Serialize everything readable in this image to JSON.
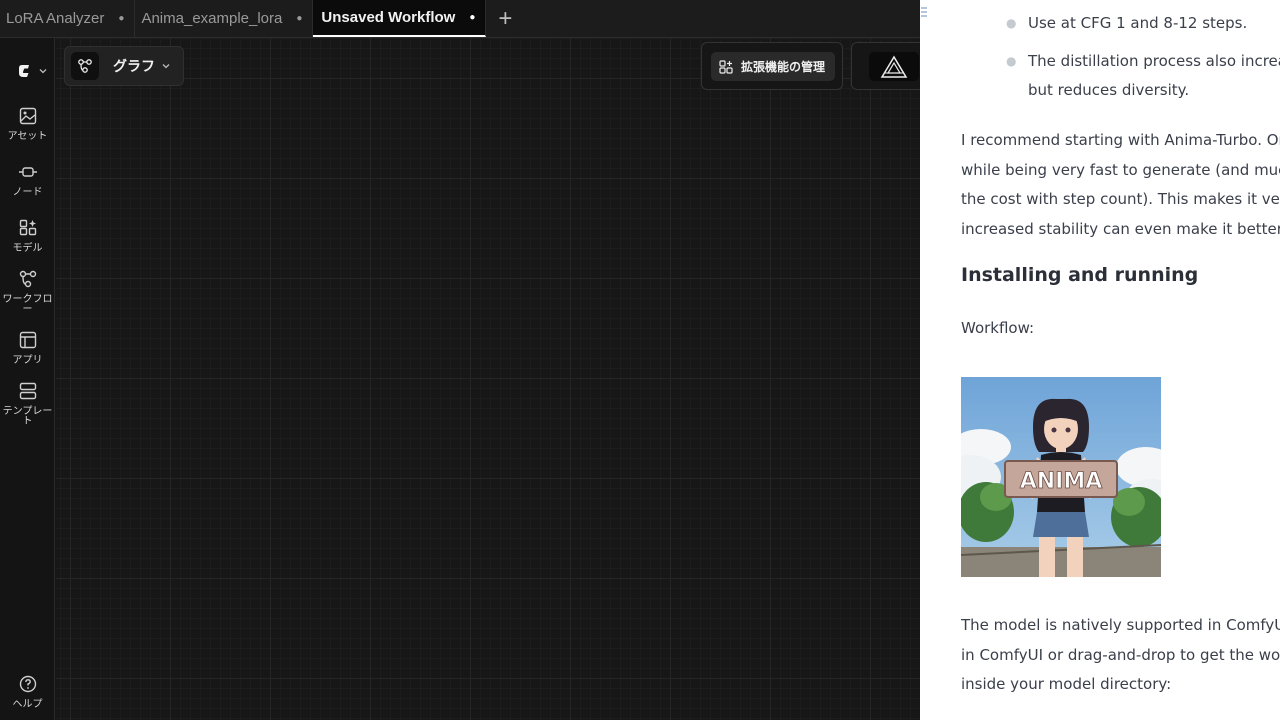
{
  "tabs": [
    {
      "label": "LoRA Analyzer",
      "modified": true,
      "active": false
    },
    {
      "label": "Anima_example_lora",
      "modified": true,
      "active": false
    },
    {
      "label": "Unsaved Workflow",
      "modified": true,
      "active": true
    }
  ],
  "tab_modified_glyph": "●",
  "tab_add_glyph": "+",
  "sidebar": {
    "items": [
      {
        "label": "アセット",
        "icon": "image-icon"
      },
      {
        "label": "ノード",
        "icon": "node-icon"
      },
      {
        "label": "モデル",
        "icon": "model-icon"
      },
      {
        "label": "ワークフロー",
        "icon": "workflow-icon"
      },
      {
        "label": "アプリ",
        "icon": "app-icon"
      },
      {
        "label": "テンプレート",
        "icon": "template-icon"
      }
    ],
    "help_label": "ヘルプ"
  },
  "toolbar": {
    "graph_label": "グラフ",
    "extensions_label": "拡張機能の管理"
  },
  "doc": {
    "bullets": [
      "Use at CFG 1 and 8-12 steps.",
      "The distillation process also increase",
      "but reduces diversity."
    ],
    "paragraph1": [
      "I recommend starting with Anima-Turbo. On a",
      "while being very fast to generate (and much ch",
      "the cost with step count). This makes it very co",
      "increased stability can even make it better tha"
    ],
    "heading": "Installing and running",
    "workflow_label": "Workflow:",
    "image_sign_text": "ANIMA",
    "paragraph2": [
      "The model is natively supported in ComfyUI. T",
      "in ComfyUI or drag-and-drop to get the workfl",
      "inside your model directory:"
    ]
  },
  "colors": {
    "canvas_bg": "#171717",
    "doc_bg": "#ffffff",
    "active_tab_bg": "#0b0b0b"
  }
}
